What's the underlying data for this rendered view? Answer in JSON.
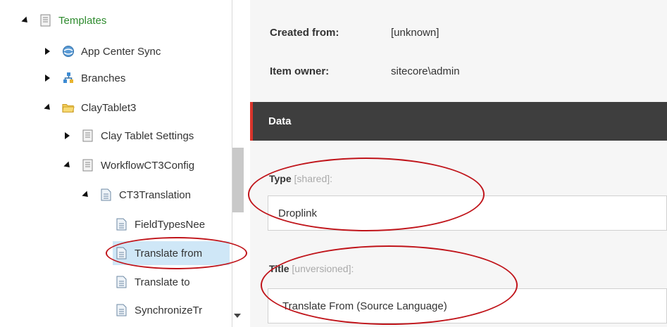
{
  "tree": {
    "items": [
      {
        "label": "Templates",
        "icon": "template-doc-icon",
        "toggle": "expanded",
        "green": true
      },
      {
        "label": "App Center Sync",
        "icon": "globe-sync-icon",
        "toggle": "collapsed"
      },
      {
        "label": "Branches",
        "icon": "branches-icon",
        "toggle": "collapsed"
      },
      {
        "label": "ClayTablet3",
        "icon": "folder-icon",
        "toggle": "expanded"
      },
      {
        "label": "Clay Tablet Settings",
        "icon": "template-doc-icon",
        "toggle": "collapsed"
      },
      {
        "label": "WorkflowCT3Config",
        "icon": "template-doc-icon",
        "toggle": "expanded"
      },
      {
        "label": "CT3Translation",
        "icon": "document-icon",
        "toggle": "expanded"
      },
      {
        "label": "FieldTypesNee",
        "icon": "document-icon",
        "toggle": "none"
      },
      {
        "label": "Translate from",
        "icon": "document-icon",
        "toggle": "none",
        "selected": true
      },
      {
        "label": "Translate to",
        "icon": "document-icon",
        "toggle": "none"
      },
      {
        "label": "SynchronizeTr",
        "icon": "document-icon",
        "toggle": "none"
      }
    ]
  },
  "details": {
    "created_from_label": "Created from:",
    "created_from_value": "[unknown]",
    "item_owner_label": "Item owner:",
    "item_owner_value": "sitecore\\admin"
  },
  "section": {
    "title": "Data"
  },
  "fields": {
    "type": {
      "label": "Type",
      "meta": "[shared]:",
      "value": "Droplink"
    },
    "title": {
      "label": "Title",
      "meta": "[unversioned]:",
      "value": "Translate From (Source Language)"
    }
  },
  "colors": {
    "accent_red": "#d9342b",
    "annotation_red": "#c0141a",
    "selected_bg": "#cfe7f7",
    "header_dark": "#3e3e3e",
    "templates_green": "#2e8b2e"
  }
}
